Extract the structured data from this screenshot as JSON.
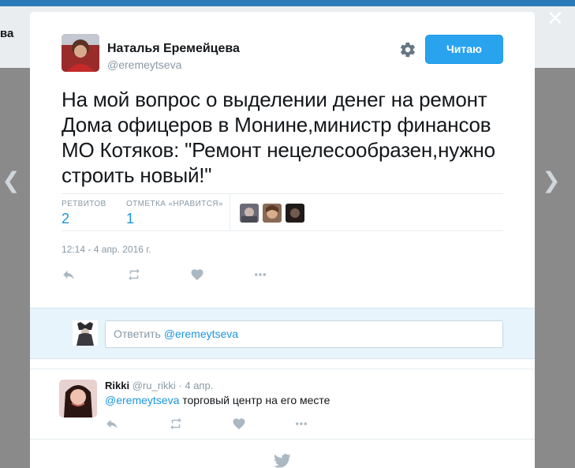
{
  "background": {
    "partial_text": "ва"
  },
  "tweet": {
    "author_name": "Наталья Еремейцева",
    "author_handle": "@eremeytseva",
    "follow_label": "Читаю",
    "text": "На мой вопрос о выделении денег на ремонт Дома офицеров в Монине,министр финансов МО Котяков: \"Ремонт нецелесообразен,нужно строить новый!\"",
    "retweets_label": "РЕТВИТОВ",
    "retweets_count": "2",
    "likes_label": "ОТМЕТКА «НРАВИТСЯ»",
    "likes_count": "1",
    "timestamp": "12:14 - 4 апр. 2016 г."
  },
  "reply_box": {
    "prefix": "Ответить ",
    "mention": "@eremeytseva"
  },
  "reply": {
    "name": "Rikki",
    "handle": "@ru_rikki",
    "separator": " · ",
    "time": "4 апр.",
    "mention": "@eremeytseva",
    "text": " торговый центр на его месте"
  },
  "icons": {
    "close": "close-icon",
    "gear": "gear-icon",
    "reply": "reply-icon",
    "retweet": "retweet-icon",
    "like": "heart-icon",
    "more": "more-icon",
    "bird": "twitter-bird-icon"
  },
  "colors": {
    "accent": "#1b95e0",
    "follow_button": "#2aa3ef",
    "reply_bg": "#e8f4fb",
    "muted": "#8899a6"
  }
}
